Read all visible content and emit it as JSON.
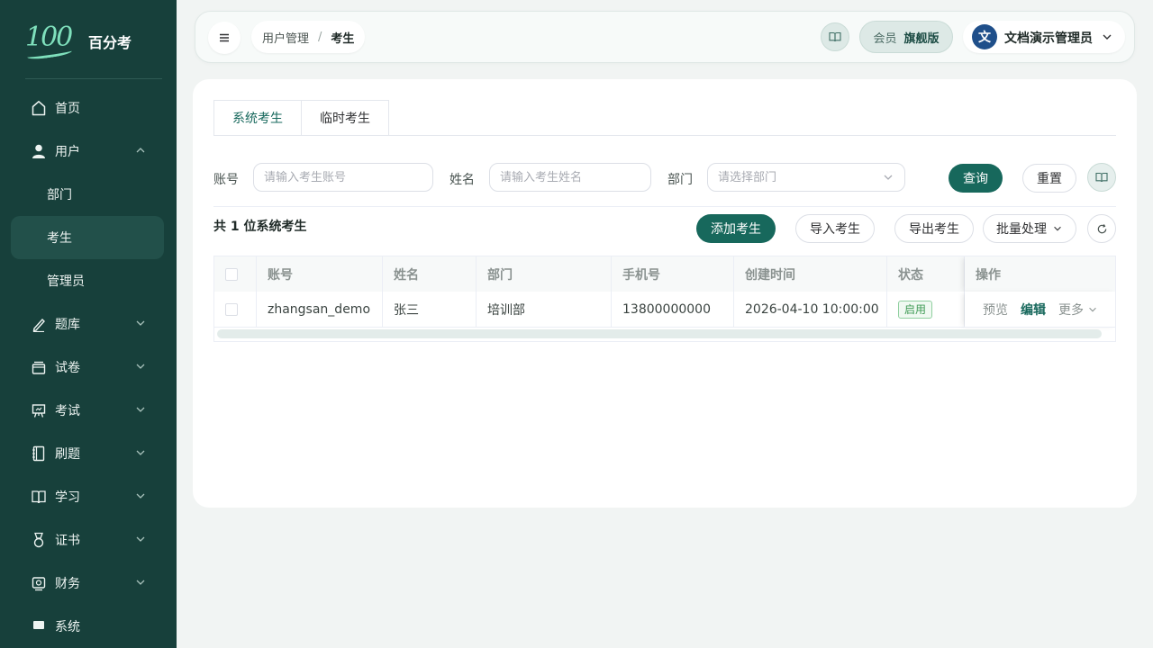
{
  "app": {
    "logo_mark": "100",
    "logo_text": "百分考"
  },
  "sidebar": {
    "items": [
      {
        "label": "首页"
      },
      {
        "label": "用户"
      },
      {
        "label": "部门"
      },
      {
        "label": "考生"
      },
      {
        "label": "管理员"
      },
      {
        "label": "题库"
      },
      {
        "label": "试卷"
      },
      {
        "label": "考试"
      },
      {
        "label": "刷题"
      },
      {
        "label": "学习"
      },
      {
        "label": "证书"
      },
      {
        "label": "财务"
      },
      {
        "label": "系统"
      }
    ]
  },
  "header": {
    "breadcrumb": [
      "用户管理",
      "考生"
    ],
    "breadcrumb_sep": "/",
    "member_label": "会员",
    "member_tier": "旗舰版",
    "avatar_text": "文",
    "username": "文档演示管理员"
  },
  "tabs": [
    {
      "label": "系统考生",
      "active": true
    },
    {
      "label": "临时考生",
      "active": false
    }
  ],
  "filters": {
    "account_label": "账号",
    "account_placeholder": "请输入考生账号",
    "name_label": "姓名",
    "name_placeholder": "请输入考生姓名",
    "dept_label": "部门",
    "dept_placeholder": "请选择部门",
    "search_button": "查询",
    "reset_button": "重置"
  },
  "toolbar": {
    "total_prefix": "共",
    "total_count": "1",
    "total_suffix": "位系统考生",
    "add_button": "添加考生",
    "import_button": "导入考生",
    "export_button": "导出考生",
    "batch_button": "批量处理"
  },
  "table": {
    "columns": [
      "账号",
      "姓名",
      "部门",
      "手机号",
      "创建时间",
      "状态",
      "操作"
    ],
    "rows": [
      {
        "account": "zhangsan_demo",
        "name": "张三",
        "dept": "培训部",
        "phone": "13800000000",
        "created": "2026-04-10 10:00:00",
        "status": "启用",
        "actions": [
          "预览",
          "编辑",
          "更多"
        ]
      }
    ]
  },
  "colors": {
    "sidebar_bg": "#17403b",
    "primary": "#17685c",
    "status_green": "#3f9a55"
  }
}
